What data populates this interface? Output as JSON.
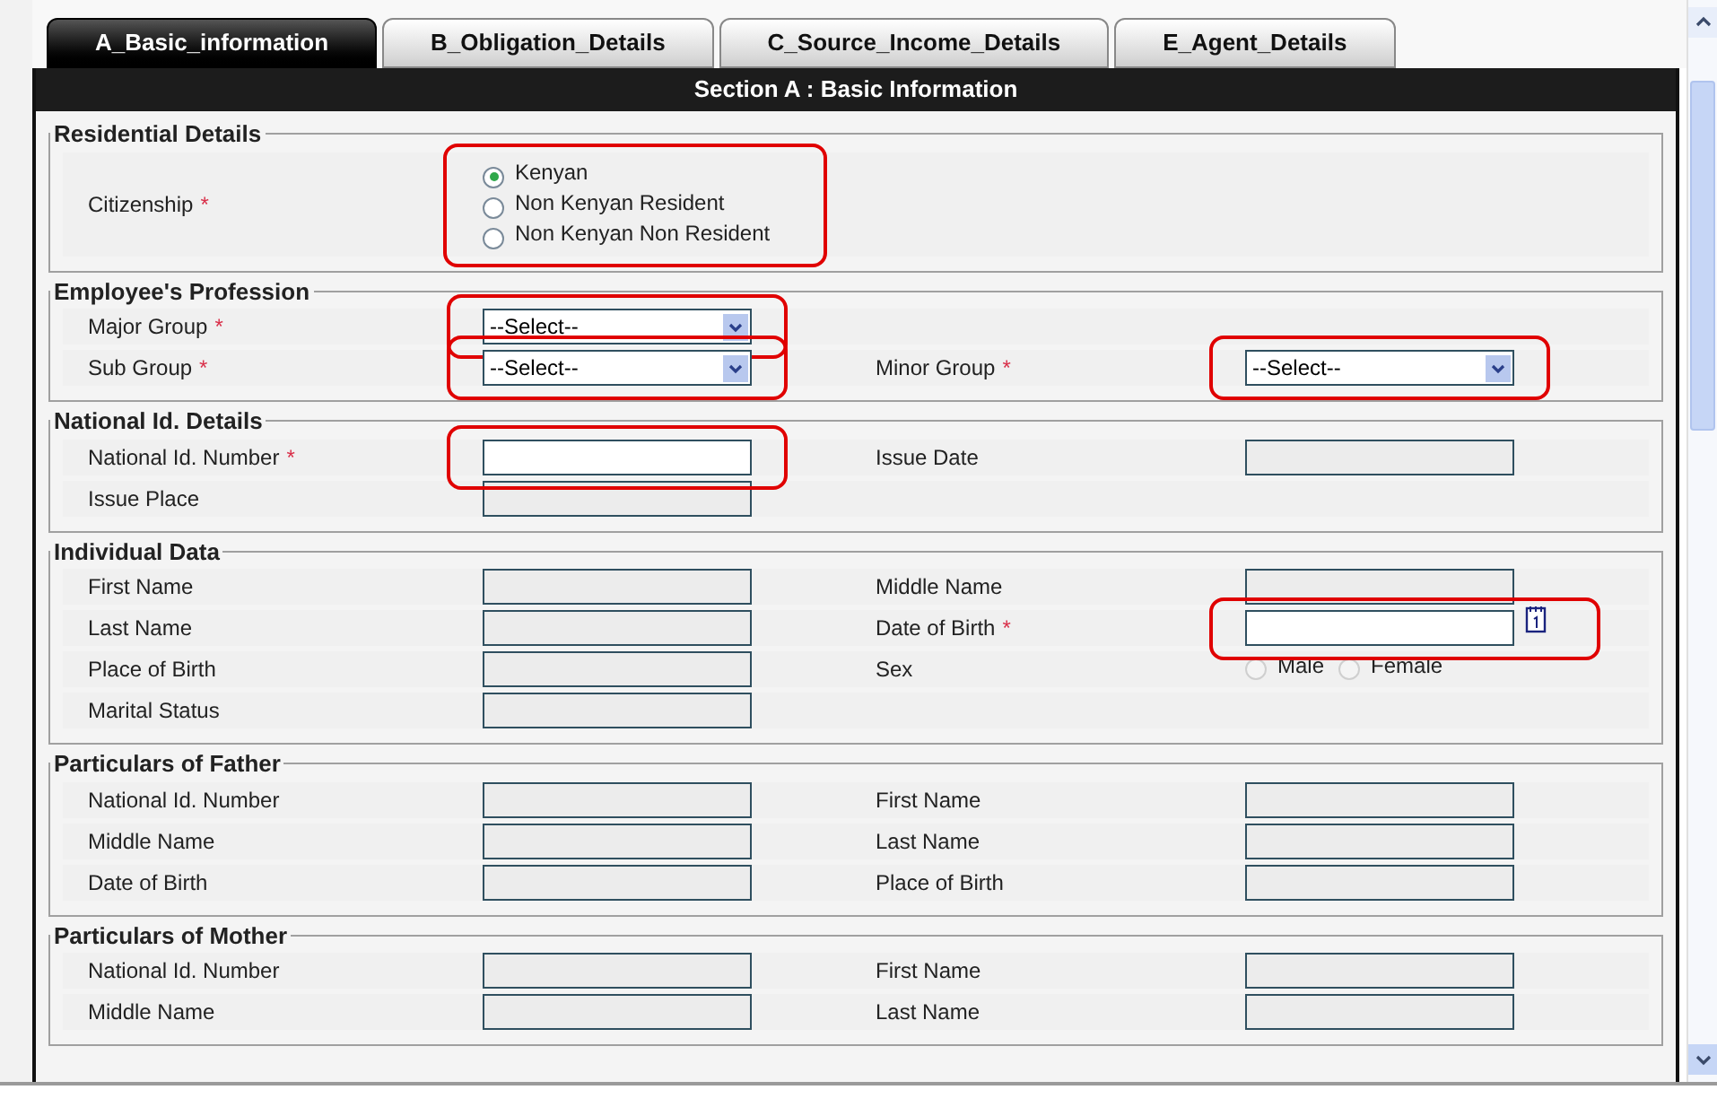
{
  "tabs": [
    {
      "label": "A_Basic_information",
      "selected": true
    },
    {
      "label": "B_Obligation_Details",
      "selected": false
    },
    {
      "label": "C_Source_Income_Details",
      "selected": false
    },
    {
      "label": "E_Agent_Details",
      "selected": false
    }
  ],
  "section_title": "Section A : Basic Information",
  "fieldsets": [
    {
      "legend": "Residential Details",
      "rows": [
        {
          "left": {
            "label": "Citizenship",
            "marker": "*",
            "control": {
              "kind": "radio",
              "disabled": false,
              "highlighted": true,
              "options": [
                {
                  "label": "Kenyan",
                  "selected": true
                },
                {
                  "label": "Non Kenyan Resident",
                  "selected": false
                },
                {
                  "label": "Non Kenyan Non Resident",
                  "selected": false
                }
              ]
            }
          }
        }
      ]
    },
    {
      "legend": "Employee's Profession",
      "rows": [
        {
          "left": {
            "label": "Major Group",
            "marker": "*",
            "control": {
              "kind": "select",
              "value": "--Select--",
              "highlighted": true
            }
          }
        },
        {
          "left": {
            "label": "Sub Group",
            "marker": "*",
            "control": {
              "kind": "select",
              "value": "--Select--",
              "highlighted": true
            }
          },
          "right": {
            "label": "Minor Group",
            "marker": "*",
            "control": {
              "kind": "select",
              "value": "--Select--",
              "highlighted": true
            }
          }
        }
      ]
    },
    {
      "legend": "National Id. Details",
      "rows": [
        {
          "left": {
            "label": "National Id. Number",
            "marker": "*",
            "control": {
              "kind": "text",
              "disabled": false,
              "highlighted": true
            }
          },
          "right": {
            "label": "Issue Date",
            "control": {
              "kind": "text",
              "disabled": true
            }
          }
        },
        {
          "left": {
            "label": "Issue Place",
            "control": {
              "kind": "text",
              "disabled": true
            }
          }
        }
      ]
    },
    {
      "legend": "Individual Data",
      "rows": [
        {
          "left": {
            "label": "First Name",
            "control": {
              "kind": "text",
              "disabled": true
            }
          },
          "right": {
            "label": "Middle Name",
            "control": {
              "kind": "text",
              "disabled": true
            }
          }
        },
        {
          "left": {
            "label": "Last Name",
            "control": {
              "kind": "text",
              "disabled": true
            }
          },
          "right": {
            "label": "Date of Birth",
            "marker": "*",
            "control": {
              "kind": "date",
              "disabled": false,
              "highlighted": true
            }
          }
        },
        {
          "left": {
            "label": "Place of Birth",
            "control": {
              "kind": "text",
              "disabled": true
            }
          },
          "right": {
            "label": "Sex",
            "control": {
              "kind": "radio",
              "disabled": true,
              "options": [
                {
                  "label": "Male",
                  "selected": false
                },
                {
                  "label": "Female",
                  "selected": false
                }
              ]
            }
          }
        },
        {
          "left": {
            "label": "Marital Status",
            "control": {
              "kind": "text",
              "disabled": true
            }
          }
        }
      ]
    },
    {
      "legend": "Particulars of Father",
      "rows": [
        {
          "left": {
            "label": "National Id. Number",
            "control": {
              "kind": "text",
              "disabled": true
            }
          },
          "right": {
            "label": "First Name",
            "control": {
              "kind": "text",
              "disabled": true
            }
          }
        },
        {
          "left": {
            "label": "Middle Name",
            "control": {
              "kind": "text",
              "disabled": true
            }
          },
          "right": {
            "label": "Last Name",
            "control": {
              "kind": "text",
              "disabled": true
            }
          }
        },
        {
          "left": {
            "label": "Date of Birth",
            "control": {
              "kind": "text",
              "disabled": true
            }
          },
          "right": {
            "label": "Place of Birth",
            "control": {
              "kind": "text",
              "disabled": true
            }
          }
        }
      ]
    },
    {
      "legend": "Particulars of Mother",
      "rows": [
        {
          "left": {
            "label": "National Id. Number",
            "control": {
              "kind": "text",
              "disabled": true
            }
          },
          "right": {
            "label": "First Name",
            "control": {
              "kind": "text",
              "disabled": true
            }
          }
        },
        {
          "left": {
            "label": "Middle Name",
            "control": {
              "kind": "text",
              "disabled": true
            }
          },
          "right": {
            "label": "Last Name",
            "control": {
              "kind": "text",
              "disabled": true
            }
          }
        }
      ]
    }
  ]
}
